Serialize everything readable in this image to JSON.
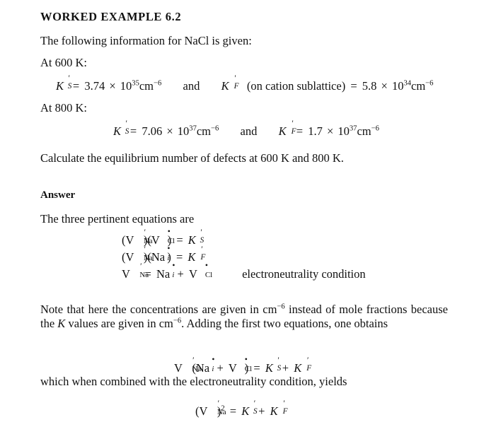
{
  "document": {
    "heading": "WORKED EXAMPLE 6.2",
    "intro": "The following information for NaCl is given:",
    "at_600": "At 600 K:",
    "at_800": "At 800 K:",
    "task": "Calculate the equilibrium number of defects at 600 K and 800 K.",
    "answer_label": "Answer",
    "three_equations_lead": "The three pertinent equations are",
    "note_paragraph": "Note that here the concentrations are given in cm−3 instead of mole fractions because the K values are given in cm−6. Adding the first two equations, one obtains",
    "combined_lead": "which when combined with the electroneutrality condition, yields",
    "electroneutrality_label": "electroneutrality condition"
  },
  "data_600K": {
    "ks_symbol": "K",
    "ks_prime": "′",
    "ks_sub": "S",
    "ks_value": "3.74",
    "ks_exp_base": "10",
    "ks_exponent": "35",
    "ks_unit": "cm",
    "ks_unit_exp": "−6",
    "conjunction": "and",
    "kf_symbol": "K",
    "kf_prime": "′",
    "kf_sub": "F",
    "kf_qualifier": "(on cation sublattice)",
    "kf_value": "5.8",
    "kf_exp_base": "10",
    "kf_exponent": "34",
    "kf_unit": "cm",
    "kf_unit_exp": "−6"
  },
  "data_800K": {
    "ks_symbol": "K",
    "ks_prime": "′",
    "ks_sub": "S",
    "ks_value": "7.06",
    "ks_exp_base": "10",
    "ks_exponent": "37",
    "ks_unit": "cm",
    "ks_unit_exp": "−6",
    "conjunction": "and",
    "kf_symbol": "K",
    "kf_prime": "′",
    "kf_sub": "F",
    "kf_value": "1.7",
    "kf_exp_base": "10",
    "kf_exponent": "37",
    "kf_unit": "cm",
    "kf_unit_exp": "−6"
  },
  "symbols": {
    "equals": "=",
    "plus": "+",
    "times": "×",
    "minus": "−",
    "prime": "′",
    "dot": "•",
    "lparen": "(",
    "rparen": ")",
    "V": "V",
    "Na": "Na",
    "Cl": "Cl",
    "sub_Na": "Na",
    "sub_Cl": "Cl",
    "sub_i": "i",
    "K": "K",
    "sub_S": "S",
    "sub_F": "F",
    "squared": "2"
  },
  "equations": {
    "eq1_text": "(V′Na)(V•Cl) = K′S",
    "eq2_text": "(V′Na)(Na•i) = K′F",
    "eq3_text": "V′Na = Na•i + V•Cl",
    "eq4_text": "V′Na(Na•i + V•Cl) = K′S + K′F",
    "eq5_text": "(V′Na)2 = K′S + K′F"
  },
  "units": {
    "cm_minus_3": "cm−3",
    "cm_minus_6": "cm−6"
  },
  "colors": {
    "page_background": "#ffffff",
    "text": "#111111"
  }
}
